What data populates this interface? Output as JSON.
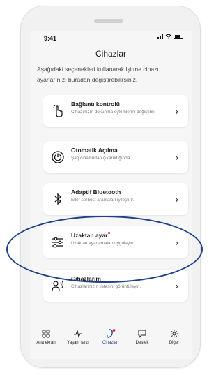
{
  "status": {
    "time": "9:41"
  },
  "header": {
    "title": "Cihazlar"
  },
  "intro_text": "Aşağıdaki seçenekleri kullanarak işitme cihazı ayarlarınızı buradan değiştirebilirsiniz.",
  "cards": [
    {
      "title": "Bağlantı kontrolü",
      "desc": "Cihazınızın dokunma eylemlerini değiştirin.",
      "icon": "touch-icon"
    },
    {
      "title": "Otomatik Açılma",
      "desc": "Şarj cihazından çıkarıldığında.",
      "icon": "power-icon"
    },
    {
      "title": "Adaptif Bluetooth",
      "desc": "Eller serbest aramaları iyileştirir.",
      "icon": "bluetooth-icon"
    },
    {
      "title": "Uzaktan ayar",
      "desc": "Uzaktan ayarlamaları uygulayın",
      "icon": "sliders-icon",
      "badge": true
    },
    {
      "title": "Cihazlarım",
      "desc": "Cihazlarınızın listesini görüntüleyin.",
      "icon": "person-sound-icon"
    }
  ],
  "tabs": [
    {
      "label": "Ana ekran",
      "icon": "grid-icon"
    },
    {
      "label": "Yaşam tarzı",
      "icon": "pulse-icon"
    },
    {
      "label": "Cihazlar",
      "icon": "hearing-aid-icon",
      "active": true
    },
    {
      "label": "Destek",
      "icon": "chat-icon"
    },
    {
      "label": "Diğer",
      "icon": "gear-icon"
    }
  ],
  "colors": {
    "accent": "#1f3f89",
    "badge": "#d0021b",
    "annotation": "#1f3f89"
  }
}
